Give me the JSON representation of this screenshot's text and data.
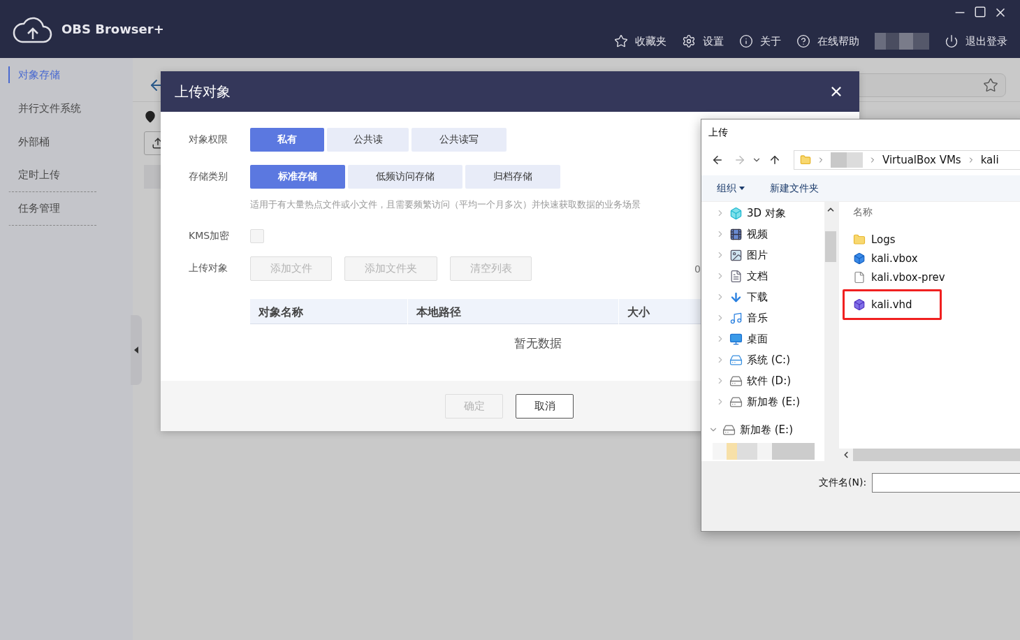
{
  "app": {
    "title": "OBS Browser+"
  },
  "nav": [
    {
      "label": "收藏夹",
      "kind": "star"
    },
    {
      "label": "设置",
      "kind": "gear"
    },
    {
      "label": "关于",
      "kind": "info"
    },
    {
      "label": "在线帮助",
      "kind": "help"
    },
    {
      "label": "退出登录",
      "kind": "power"
    }
  ],
  "sidebar": {
    "items": [
      {
        "label": "对象存储",
        "selected": true
      },
      {
        "label": "并行文件系统",
        "selected": false
      },
      {
        "label": "外部桶",
        "selected": false
      },
      {
        "label": "定时上传",
        "selected": false
      },
      {
        "label": "任务管理",
        "selected": false
      }
    ]
  },
  "dialog": {
    "title": "上传对象",
    "permission": {
      "label": "对象权限",
      "options": [
        {
          "label": "私有",
          "selected": true
        },
        {
          "label": "公共读",
          "selected": false
        },
        {
          "label": "公共读写",
          "selected": false
        }
      ]
    },
    "storage_class": {
      "label": "存储类别",
      "options": [
        {
          "label": "标准存储",
          "selected": true
        },
        {
          "label": "低频访问存储",
          "selected": false
        },
        {
          "label": "归档存储",
          "selected": false
        }
      ],
      "hint": "适用于有大量热点文件或小文件，且需要频繁访问（平均一个月多次）并快速获取数据的业务场景"
    },
    "kms": {
      "label": "KMS加密",
      "checked": false
    },
    "upload": {
      "label": "上传对象",
      "buttons": [
        {
          "label": "添加文件",
          "disabled": true
        },
        {
          "label": "添加文件夹",
          "disabled": true
        },
        {
          "label": "清空列表",
          "disabled": true
        }
      ],
      "count": "0"
    },
    "table": {
      "columns": [
        "对象名称",
        "本地路径",
        "大小"
      ],
      "empty_text": "暂无数据"
    },
    "buttons": [
      {
        "label": "确定",
        "disabled": true
      },
      {
        "label": "取消",
        "disabled": false
      }
    ]
  },
  "file_dialog": {
    "title": "上传",
    "path": [
      "VirtualBox VMs",
      "kali"
    ],
    "toolbar": [
      {
        "label": "组织",
        "dropdown": true
      },
      {
        "label": "新建文件夹",
        "dropdown": false
      }
    ],
    "tree": [
      {
        "label": "3D 对象",
        "kind": "objects3d",
        "expanded": false
      },
      {
        "label": "视频",
        "kind": "video",
        "expanded": false
      },
      {
        "label": "图片",
        "kind": "pictures",
        "expanded": false
      },
      {
        "label": "文档",
        "kind": "documents",
        "expanded": false
      },
      {
        "label": "下载",
        "kind": "downloads",
        "expanded": false
      },
      {
        "label": "音乐",
        "kind": "music",
        "expanded": false
      },
      {
        "label": "桌面",
        "kind": "desktop",
        "expanded": false
      },
      {
        "label": "系统 (C:)",
        "kind": "system_drive",
        "expanded": false
      },
      {
        "label": "软件 (D:)",
        "kind": "drive",
        "expanded": false
      },
      {
        "label": "新加卷 (E:)",
        "kind": "drive",
        "expanded": false
      },
      {
        "label": "新加卷 (E:)",
        "kind": "drive",
        "expanded": true
      }
    ],
    "column": "名称",
    "files": [
      {
        "name": "Logs",
        "kind": "folder",
        "highlighted": false
      },
      {
        "name": "kali.vbox",
        "kind": "vbox",
        "highlighted": false
      },
      {
        "name": "kali.vbox-prev",
        "kind": "file",
        "highlighted": false
      },
      {
        "name": "kali.vhd",
        "kind": "disk",
        "highlighted": true
      }
    ],
    "filename_label": "文件名(N):"
  }
}
